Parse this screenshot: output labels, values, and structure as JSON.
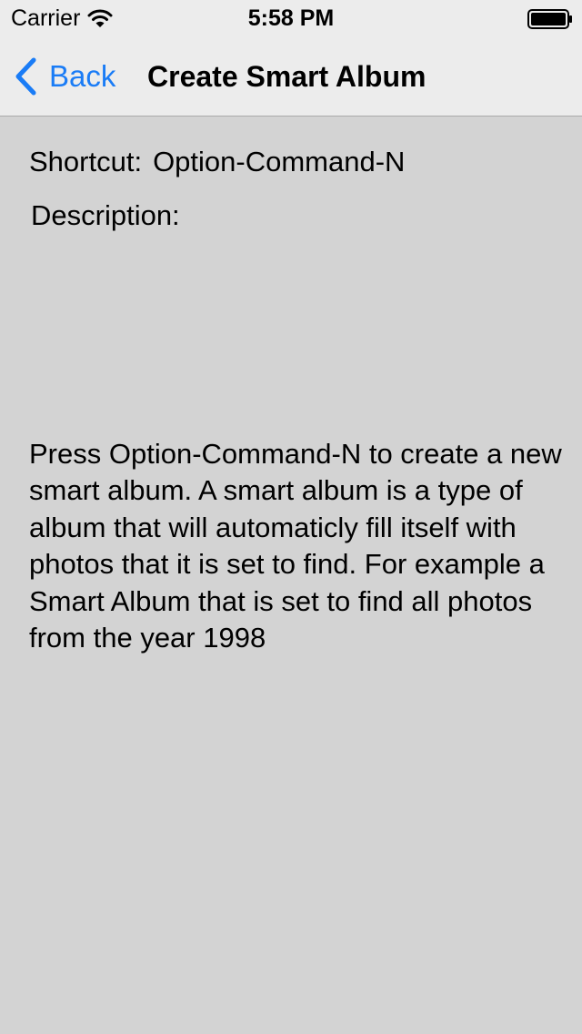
{
  "status_bar": {
    "carrier": "Carrier",
    "time": "5:58 PM",
    "wifi_icon": "wifi-icon",
    "battery_icon": "battery-icon",
    "battery_level": 1.0
  },
  "nav": {
    "back_label": "Back",
    "back_icon": "chevron-left-icon",
    "title": "Create Smart Album",
    "accent_color": "#1a7cf6"
  },
  "detail": {
    "shortcut_label": "Shortcut:",
    "shortcut_value": "Option-Command-N",
    "description_label": "Description:",
    "description_text": "Press Option-Command-N to create a new smart album. A smart album is a type of album that will automaticly fill itself with photos that it is set to find. For example a Smart Album that is set to find all photos from the year 1998"
  },
  "colors": {
    "background": "#d3d3d3",
    "header_background": "#ececec"
  }
}
